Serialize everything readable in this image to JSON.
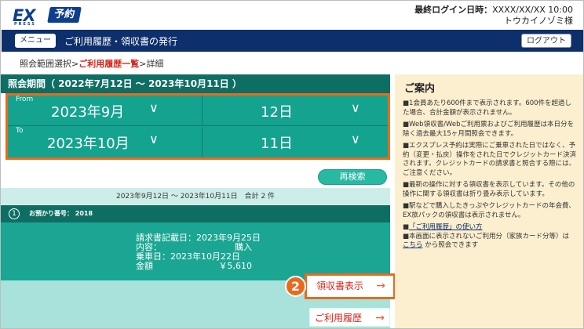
{
  "header": {
    "logo_ex": "EX",
    "logo_yoyaku": "予約",
    "logo_press": "PRESS",
    "last_login_label": "最終ログイン日時：",
    "last_login_value": "XXXX/XX/XX 10:00",
    "user_name": "トウカイノゾミ様"
  },
  "navbar": {
    "menu_label": "メニュー",
    "title": "ご利用履歴・領収書の発行",
    "logout_label": "ログアウト"
  },
  "breadcrumb": {
    "step1": "照会範囲選択",
    "sep": ">",
    "step2": "ご利用履歴一覧",
    "step3": "詳細"
  },
  "period": {
    "heading": "照会期間（ 2022年7月12日 〜 2023年10月11日 ）",
    "from_label": "From",
    "from_month": "2023年9月",
    "from_day": "12日",
    "to_label": "To",
    "to_month": "2023年10月",
    "to_day": "11日"
  },
  "search": {
    "button_label": "再検索"
  },
  "result": {
    "summary": "2023年9月12日 〜 2023年10月11日　合計 2 件"
  },
  "order": {
    "index": "1",
    "label": "お預かり番号： 2018",
    "invoice_date_label": "請求書記載日：",
    "invoice_date": "2023年9月25日",
    "type_label": "内容：",
    "type_value": "購入",
    "ride_date_label": "乗車日：",
    "ride_date": "2023年10月22日",
    "amount_label": "金額",
    "amount_value": "￥5,610"
  },
  "actions": {
    "callout_number": "2",
    "receipt_label": "領収書表示",
    "history_label": "ご利用履歴",
    "arrow": "→"
  },
  "guide": {
    "title": "ご案内",
    "items": [
      "■1会員あたり600件まで表示されます。600件を超過した場合、合計金額が表示されません。",
      "■Web領収書/Webご利用票およびご利用履歴は本日分を除く過去最大15ヶ月間照会できます。",
      "■エクスプレス予約は実際にご乗車された日ではなく、予約（変更・払戻）操作をされた日でクレジットカード決済されます。クレジットカードの請求書と照合する際には、ご注意ください。",
      "■最新の操作に対する領収書を表示しています。その他の操作に関する領収書は折り畳み表示しています。",
      "■駅などで購入したきっぷやクレジットカードの年会費、EX旅パックの領収書は表示されません。"
    ],
    "link1_prefix": "■",
    "link1": "「ご利用履歴」の使い方",
    "last_prefix": "■本画面に表示されないご利用分（家族カード分等）は ",
    "last_link": "こちら",
    "last_suffix": " から照会できます"
  },
  "colors": {
    "navy": "#0d2f6b",
    "teal_dark": "#0f6e63",
    "teal": "#14a38f",
    "highlight": "#ea6a1c",
    "link_red": "#d9261c",
    "guide_bg": "#fbefcf"
  }
}
